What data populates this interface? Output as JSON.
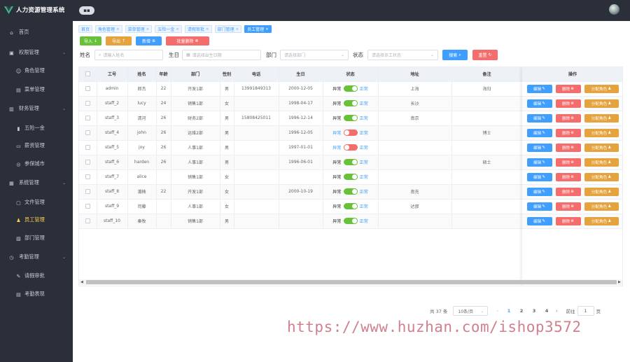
{
  "app": {
    "title": "人力资源管理系统"
  },
  "sidebar": {
    "items": [
      {
        "label": "首页",
        "icon": "home-icon",
        "type": "item"
      },
      {
        "label": "权限管理",
        "icon": "lock-icon",
        "type": "group"
      },
      {
        "label": "角色管理",
        "icon": "user-icon",
        "type": "sub"
      },
      {
        "label": "菜单管理",
        "icon": "menu-icon",
        "type": "sub"
      },
      {
        "label": "财务管理",
        "icon": "finance-icon",
        "type": "group"
      },
      {
        "label": "五险一金",
        "icon": "bar-chart-icon",
        "type": "sub"
      },
      {
        "label": "薪资管理",
        "icon": "wallet-icon",
        "type": "sub"
      },
      {
        "label": "参保城市",
        "icon": "location-icon",
        "type": "sub"
      },
      {
        "label": "系统管理",
        "icon": "system-icon",
        "type": "group"
      },
      {
        "label": "文件管理",
        "icon": "folder-icon",
        "type": "sub"
      },
      {
        "label": "员工管理",
        "icon": "employee-icon",
        "type": "sub",
        "active": true
      },
      {
        "label": "部门管理",
        "icon": "department-icon",
        "type": "sub"
      },
      {
        "label": "考勤管理",
        "icon": "attendance-icon",
        "type": "group"
      },
      {
        "label": "请假审批",
        "icon": "approval-icon",
        "type": "sub"
      },
      {
        "label": "考勤表现",
        "icon": "report-icon",
        "type": "sub"
      }
    ]
  },
  "tabs": [
    {
      "label": "首页",
      "closable": false,
      "active": false
    },
    {
      "label": "角色管理",
      "closable": true,
      "active": false
    },
    {
      "label": "菜单管理",
      "closable": true,
      "active": false
    },
    {
      "label": "五险一金",
      "closable": true,
      "active": false
    },
    {
      "label": "请假审批",
      "closable": true,
      "active": false
    },
    {
      "label": "部门管理",
      "closable": true,
      "active": false
    },
    {
      "label": "员工管理",
      "closable": true,
      "active": true
    }
  ],
  "toolbar": {
    "import": "导入",
    "export": "导出",
    "add": "新增",
    "batch_delete": "批量删除"
  },
  "filters": {
    "name_label": "姓名",
    "name_placeholder": "请输入姓名",
    "birth_label": "生日",
    "birth_placeholder": "请选择出生日期",
    "dept_label": "部门",
    "dept_placeholder": "请选择部门",
    "status_label": "状态",
    "status_placeholder": "请选择员工状态",
    "search": "搜索",
    "reset": "重置"
  },
  "table": {
    "columns": [
      "工号",
      "姓名",
      "年龄",
      "部门",
      "性别",
      "电话",
      "生日",
      "状态",
      "地址",
      "备注"
    ],
    "ops_header": "操作",
    "status_off_label": "异常",
    "status_on_label": "正常",
    "rows": [
      {
        "id": "admin",
        "name": "郎杰",
        "age": "22",
        "dept": "开发1部",
        "gender": "男",
        "phone": "13991849313",
        "birthday": "2000-12-05",
        "status_on": true,
        "address": "上海",
        "note": "海归"
      },
      {
        "id": "staff_2",
        "name": "lucy",
        "age": "24",
        "dept": "销售1部",
        "gender": "女",
        "phone": "",
        "birthday": "1998-04-17",
        "status_on": true,
        "address": "长沙",
        "note": ""
      },
      {
        "id": "staff_3",
        "name": "清河",
        "age": "26",
        "dept": "财务2部",
        "gender": "男",
        "phone": "15808425011",
        "birthday": "1996-12-14",
        "status_on": true,
        "address": "南京",
        "note": ""
      },
      {
        "id": "staff_4",
        "name": "john",
        "age": "26",
        "dept": "运维2部",
        "gender": "男",
        "phone": "",
        "birthday": "1996-12-05",
        "status_on": false,
        "address": "",
        "note": "博士"
      },
      {
        "id": "staff_5",
        "name": "joy",
        "age": "26",
        "dept": "人事1部",
        "gender": "男",
        "phone": "",
        "birthday": "1997-01-01",
        "status_on": false,
        "address": "",
        "note": ""
      },
      {
        "id": "staff_6",
        "name": "harden",
        "age": "26",
        "dept": "人事1部",
        "gender": "男",
        "phone": "",
        "birthday": "1996-06-01",
        "status_on": true,
        "address": "",
        "note": "硕士"
      },
      {
        "id": "staff_7",
        "name": "alice",
        "age": "",
        "dept": "销售1部",
        "gender": "女",
        "phone": "",
        "birthday": "",
        "status_on": true,
        "address": "",
        "note": ""
      },
      {
        "id": "staff_8",
        "name": "潮楠",
        "age": "22",
        "dept": "开发1部",
        "gender": "女",
        "phone": "",
        "birthday": "2000-10-19",
        "status_on": true,
        "address": "南充",
        "note": ""
      },
      {
        "id": "staff_9",
        "name": "司藤",
        "age": "",
        "dept": "人事1部",
        "gender": "女",
        "phone": "",
        "birthday": "",
        "status_on": true,
        "address": "达那",
        "note": ""
      },
      {
        "id": "staff_10",
        "name": "秦牧",
        "age": "",
        "dept": "销售1部",
        "gender": "男",
        "phone": "",
        "birthday": "",
        "status_on": true,
        "address": "",
        "note": ""
      }
    ],
    "op_labels": {
      "edit": "编辑",
      "delete": "删除",
      "assign_role": "分配角色"
    }
  },
  "pagination": {
    "total_label": "共 37 条",
    "page_size": "10条/页",
    "pages": [
      "1",
      "2",
      "3",
      "4"
    ],
    "current_page": "1",
    "goto_label": "前往",
    "goto_value": "1",
    "page_unit": "页"
  },
  "watermark": "https://www.huzhan.com/ishop3572",
  "colors": {
    "sidebar_bg": "#2b2f3a",
    "primary": "#409eff",
    "success": "#67c23a",
    "warning": "#e6a23c",
    "danger": "#f56c6c",
    "active_menu": "#ffd04b"
  }
}
